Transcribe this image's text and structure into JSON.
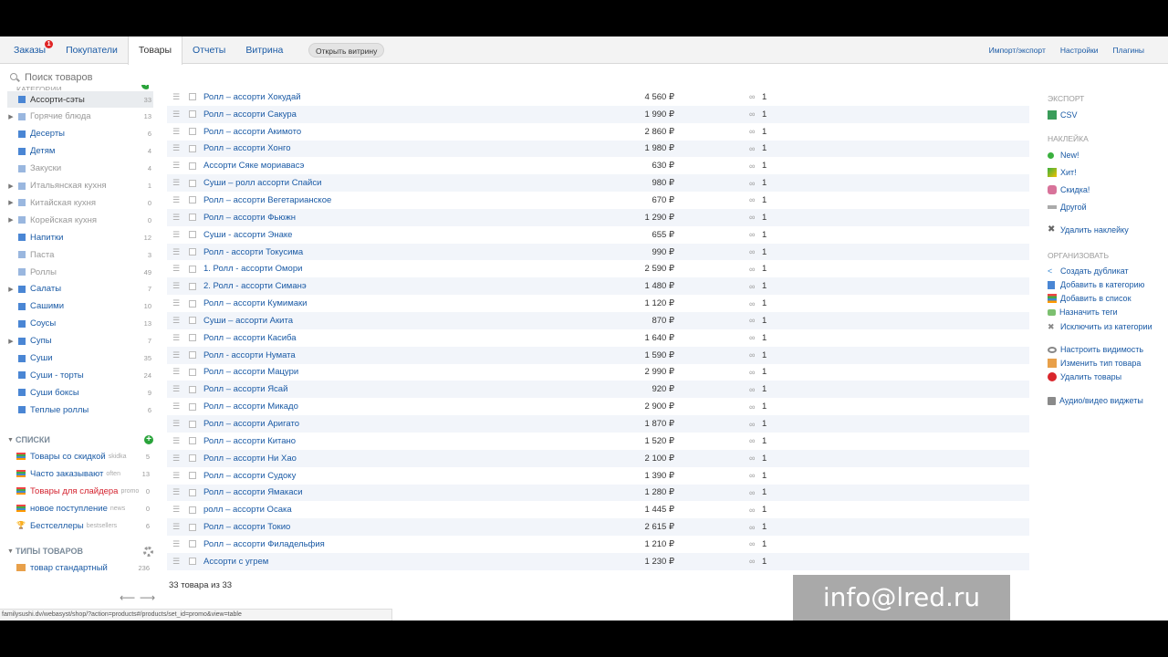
{
  "nav": {
    "tabs": [
      {
        "label": "Заказы",
        "badge": "1"
      },
      {
        "label": "Покупатели"
      },
      {
        "label": "Товары",
        "active": true
      },
      {
        "label": "Отчеты"
      },
      {
        "label": "Витрина"
      }
    ],
    "open_storefront": "Открыть витрину",
    "links": [
      "Импорт/экспорт",
      "Настройки",
      "Плагины"
    ]
  },
  "search": {
    "placeholder": "Поиск товаров"
  },
  "categories": {
    "header": "КАТЕГОРИИ",
    "items": [
      {
        "label": "Ассорти-сэты",
        "count": "33",
        "active": true
      },
      {
        "label": "Горячие блюда",
        "count": "13",
        "arrow": true,
        "dim": true
      },
      {
        "label": "Десерты",
        "count": "6"
      },
      {
        "label": "Детям",
        "count": "4"
      },
      {
        "label": "Закуски",
        "count": "4",
        "dim": true
      },
      {
        "label": "Итальянская кухня",
        "count": "1",
        "arrow": true,
        "dim": true
      },
      {
        "label": "Китайская кухня",
        "count": "0",
        "arrow": true,
        "dim": true
      },
      {
        "label": "Корейская кухня",
        "count": "0",
        "arrow": true,
        "dim": true
      },
      {
        "label": "Напитки",
        "count": "12"
      },
      {
        "label": "Паста",
        "count": "3",
        "dim": true
      },
      {
        "label": "Роллы",
        "count": "49",
        "dim": true
      },
      {
        "label": "Салаты",
        "count": "7",
        "arrow": true
      },
      {
        "label": "Сашими",
        "count": "10"
      },
      {
        "label": "Соусы",
        "count": "13"
      },
      {
        "label": "Супы",
        "count": "7",
        "arrow": true
      },
      {
        "label": "Суши",
        "count": "35"
      },
      {
        "label": "Суши - торты",
        "count": "24"
      },
      {
        "label": "Суши боксы",
        "count": "9"
      },
      {
        "label": "Теплые роллы",
        "count": "6"
      }
    ]
  },
  "lists": {
    "header": "СПИСКИ",
    "items": [
      {
        "label": "Товары со скидкой",
        "tag": "skidka",
        "count": "5"
      },
      {
        "label": "Часто заказывают",
        "tag": "often",
        "count": "13"
      },
      {
        "label": "Товары для слайдера",
        "tag": "promo",
        "count": "0",
        "highlight": true
      },
      {
        "label": "новое поступление",
        "tag": "news",
        "count": "0"
      },
      {
        "label": "Бестселлеры",
        "tag": "bestsellers",
        "count": "6",
        "trophy": true
      }
    ]
  },
  "types": {
    "header": "ТИПЫ ТОВАРОВ",
    "items": [
      {
        "label": "товар стандартный",
        "count": "236"
      }
    ]
  },
  "products": [
    {
      "name": "Ролл – ассорти Хокудай",
      "price": "4 560 ₽",
      "qty": "1"
    },
    {
      "name": "Ролл – ассорти Сакура",
      "price": "1 990 ₽",
      "qty": "1"
    },
    {
      "name": "Ролл – ассорти Акимото",
      "price": "2 860 ₽",
      "qty": "1"
    },
    {
      "name": "Ролл – ассорти Хонго",
      "price": "1 980 ₽",
      "qty": "1"
    },
    {
      "name": "Ассорти Сяке мориавасэ",
      "price": "630 ₽",
      "qty": "1"
    },
    {
      "name": "Суши – ролл ассорти Спайси",
      "price": "980 ₽",
      "qty": "1"
    },
    {
      "name": "Ролл – ассорти Вегетарианское",
      "price": "670 ₽",
      "qty": "1"
    },
    {
      "name": "Ролл – ассорти Фьюжн",
      "price": "1 290 ₽",
      "qty": "1"
    },
    {
      "name": "Суши - ассорти Энаке",
      "price": "655 ₽",
      "qty": "1"
    },
    {
      "name": "Ролл - ассорти Токусима",
      "price": "990 ₽",
      "qty": "1"
    },
    {
      "name": "1. Ролл - ассорти Омори",
      "price": "2 590 ₽",
      "qty": "1"
    },
    {
      "name": "2. Ролл - ассорти Симанэ",
      "price": "1 480 ₽",
      "qty": "1"
    },
    {
      "name": "Ролл – ассорти Кумимаки",
      "price": "1 120 ₽",
      "qty": "1"
    },
    {
      "name": "Суши – ассорти Акита",
      "price": "870 ₽",
      "qty": "1"
    },
    {
      "name": "Ролл – ассорти Касиба",
      "price": "1 640 ₽",
      "qty": "1"
    },
    {
      "name": "Ролл - ассорти Нумата",
      "price": "1 590 ₽",
      "qty": "1"
    },
    {
      "name": "Ролл – ассорти Мацури",
      "price": "2 990 ₽",
      "qty": "1"
    },
    {
      "name": "Ролл – ассорти Ясай",
      "price": "920 ₽",
      "qty": "1"
    },
    {
      "name": "Ролл – ассорти Микадо",
      "price": "2 900 ₽",
      "qty": "1"
    },
    {
      "name": "Ролл – ассорти Аригато",
      "price": "1 870 ₽",
      "qty": "1"
    },
    {
      "name": "Ролл – ассорти Китано",
      "price": "1 520 ₽",
      "qty": "1"
    },
    {
      "name": "Ролл – ассорти Ни Хао",
      "price": "2 100 ₽",
      "qty": "1"
    },
    {
      "name": "Ролл – ассорти Судоку",
      "price": "1 390 ₽",
      "qty": "1"
    },
    {
      "name": "Ролл – ассорти Ямакаси",
      "price": "1 280 ₽",
      "qty": "1"
    },
    {
      "name": "ролл – ассорти Осака",
      "price": "1 445 ₽",
      "qty": "1"
    },
    {
      "name": "Ролл – ассорти Токио",
      "price": "2 615 ₽",
      "qty": "1"
    },
    {
      "name": "Ролл – ассорти Филадельфия",
      "price": "1 210 ₽",
      "qty": "1"
    },
    {
      "name": "Ассорти с угрем",
      "price": "1 230 ₽",
      "qty": "1"
    }
  ],
  "footer_count": "33 товара из 33",
  "right_panel": {
    "export_header": "ЭКСПОРТ",
    "export_csv": "CSV",
    "badge_header": "НАКЛЕЙКА",
    "badges": [
      "New!",
      "Хит!",
      "Скидка!",
      "Другой"
    ],
    "remove_badge": "Удалить наклейку",
    "organize_header": "ОРГАНИЗОВАТЬ",
    "organize": [
      "Создать дубликат",
      "Добавить в категорию",
      "Добавить в список",
      "Назначить теги",
      "Исключить из категории"
    ],
    "visibility": [
      "Настроить видимость",
      "Изменить тип товара",
      "Удалить товары"
    ],
    "widgets": "Аудио/видео виджеты"
  },
  "status_url": "familysushi.dv/webasyst/shop/?action=products#/products/set_id=promo&view=table",
  "watermark": "info@lred.ru"
}
